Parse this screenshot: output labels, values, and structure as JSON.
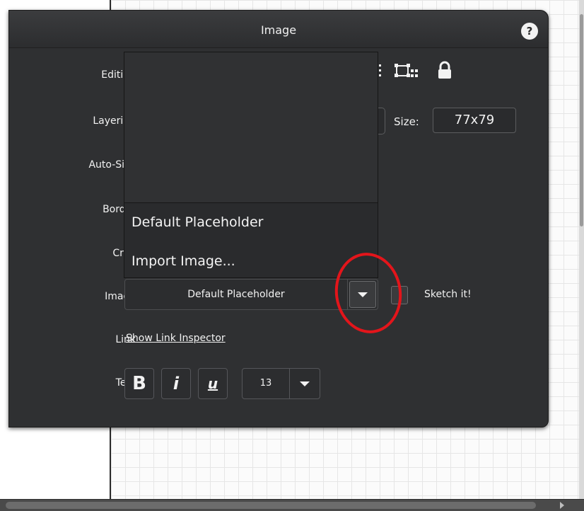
{
  "panel": {
    "title": "Image",
    "help_label": "?"
  },
  "rows": {
    "editing": "Editing",
    "layering": "Layering",
    "autosize": "Auto-Size",
    "border": "Border",
    "crop": "Crop",
    "image": "Image",
    "link": "Link",
    "text": "Text"
  },
  "size": {
    "label": "Size:",
    "value": "77x79"
  },
  "image_menu": {
    "items": [
      "Default Placeholder",
      "Import Image..."
    ]
  },
  "image_select": {
    "value": "Default Placeholder"
  },
  "sketch": {
    "label": "Sketch it!",
    "checked": false
  },
  "link": {
    "label": "Show Link Inspector"
  },
  "text_controls": {
    "bold": "B",
    "italic": "i",
    "underline": "u",
    "font_size": "13"
  },
  "icons": [
    "pointer-icon",
    "resize-icon",
    "lock-icon",
    "help-icon",
    "chevron-down-icon"
  ],
  "colors": {
    "panel_bg": "#2f3032",
    "text": "#f2f2f2",
    "annotation": "#e3151b"
  }
}
